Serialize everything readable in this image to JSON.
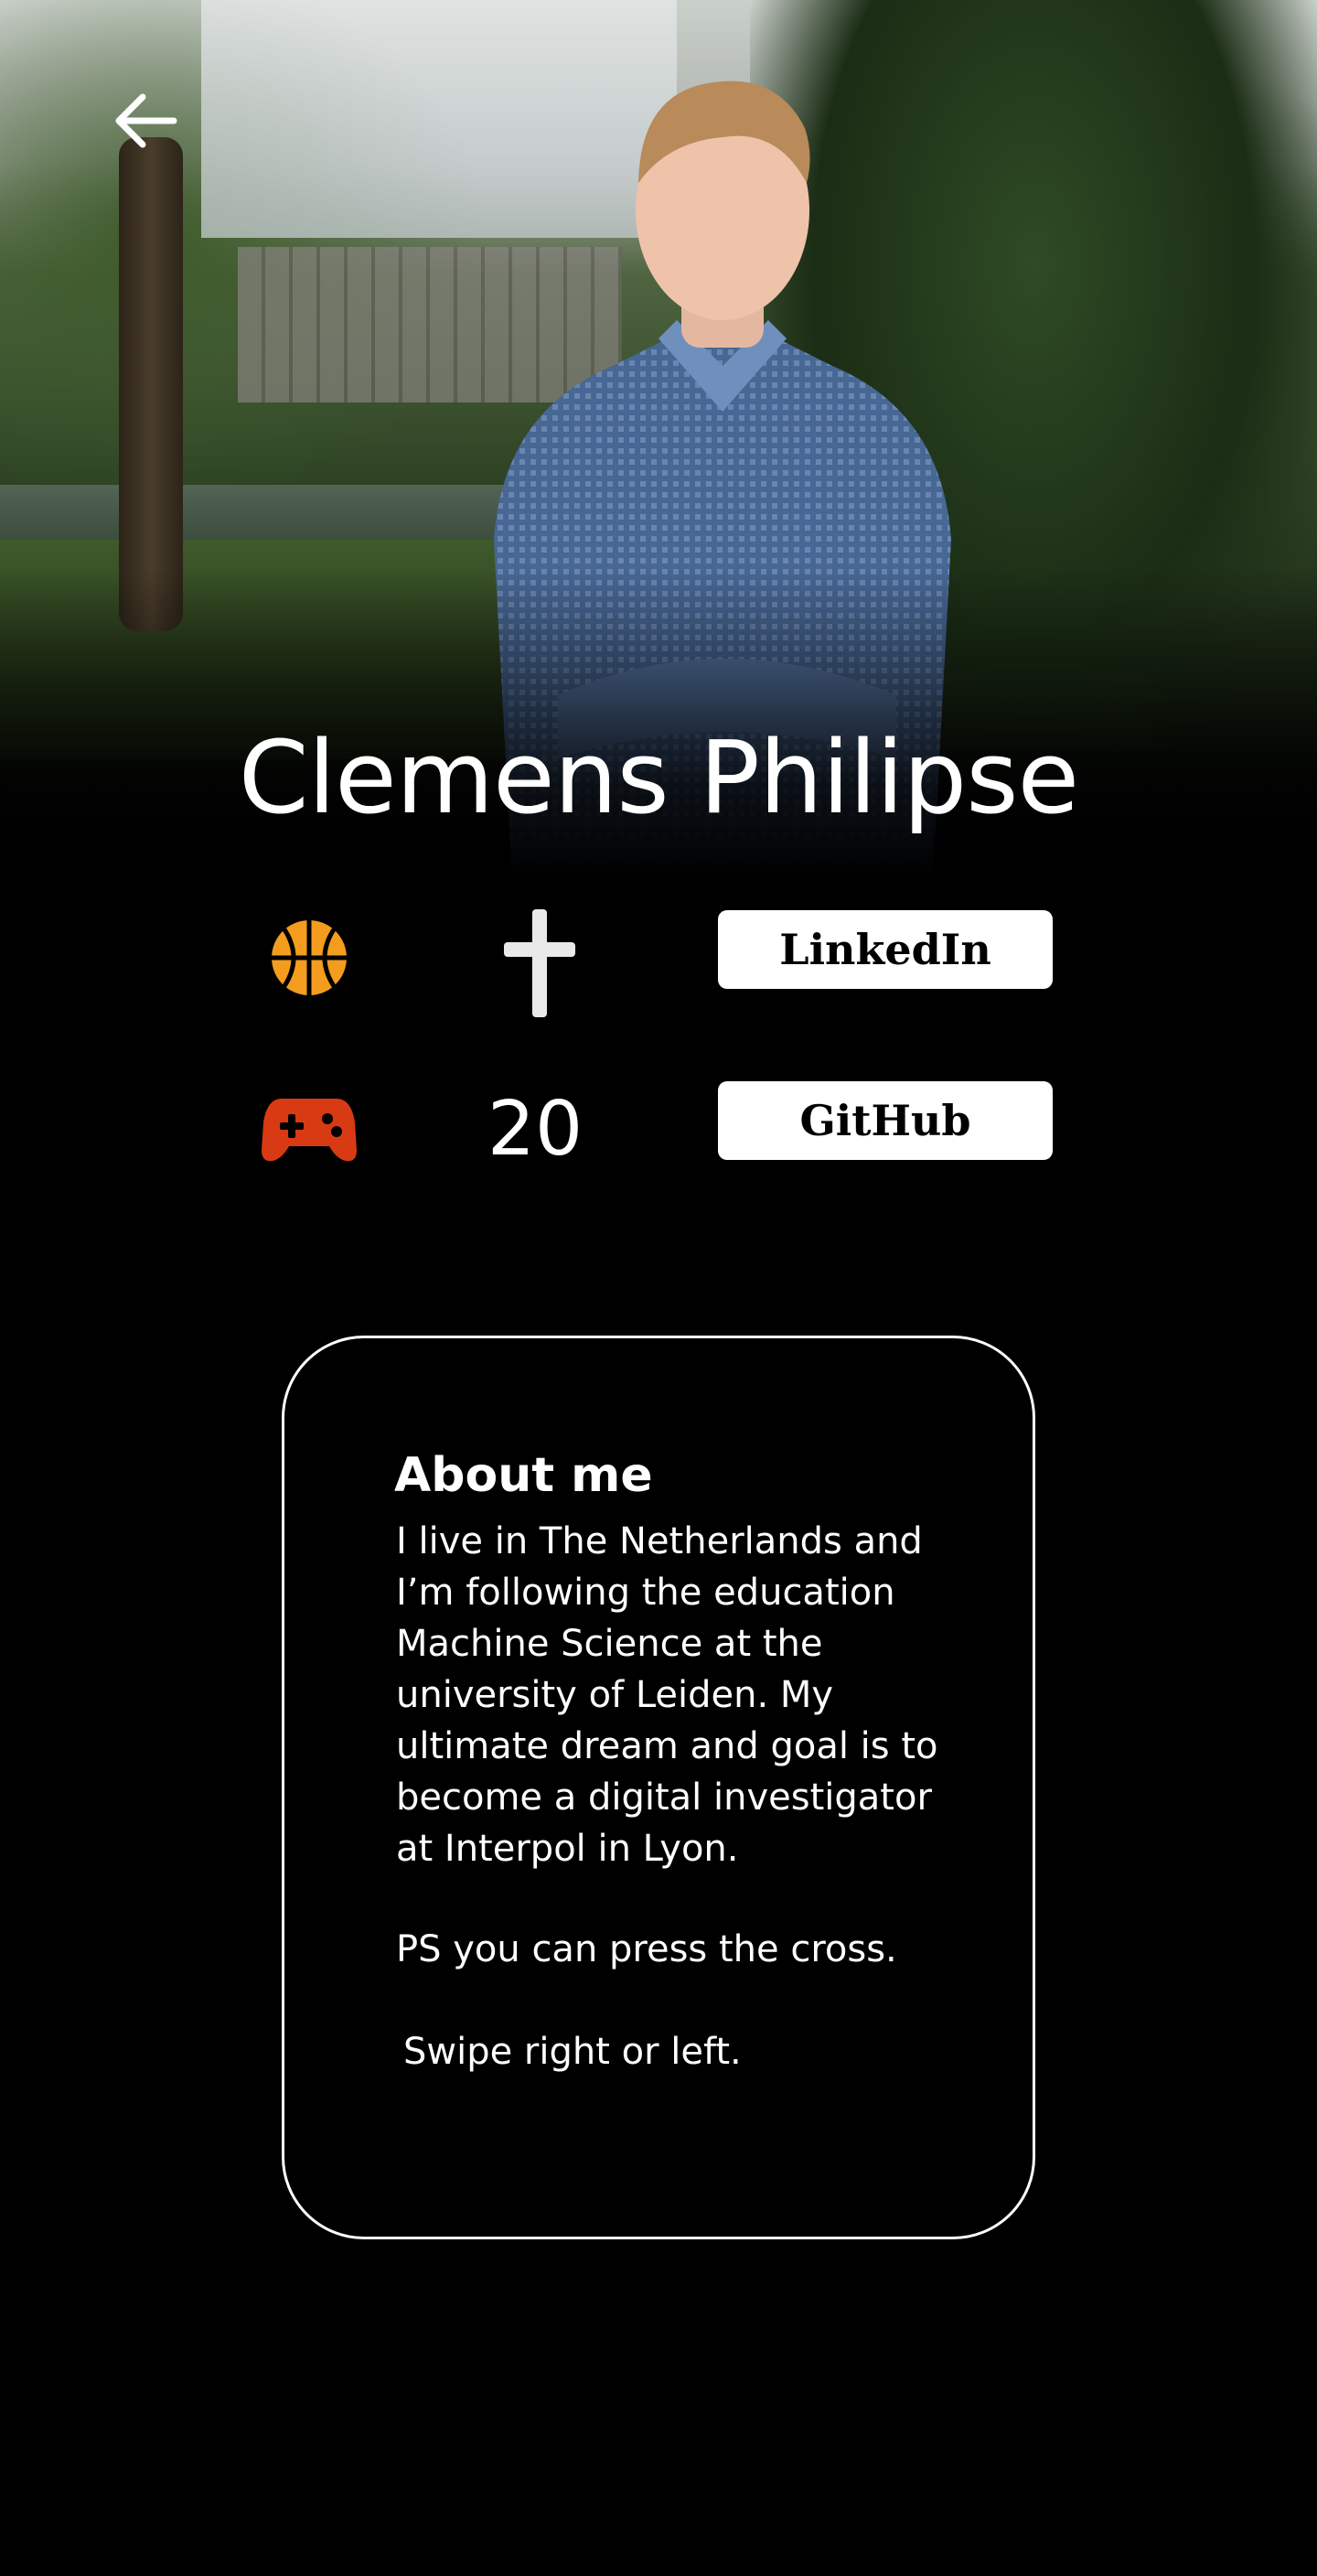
{
  "profile": {
    "name": "Clemens Philipse",
    "age": "20"
  },
  "links": {
    "linkedin_label": "LinkedIn",
    "github_label": "GitHub"
  },
  "icons": {
    "back": "arrow-left-icon",
    "hobby_sport": "basketball-icon",
    "religion": "cross-icon",
    "hobby_gaming": "gamepad-icon"
  },
  "about": {
    "title": "About me",
    "body": "I live in The Netherlands and\nI’m following the education\nMachine Science at the\nuniversity of Leiden. My\nultimate dream and goal is to\nbecome a digital investigator\nat Interpol in Lyon.",
    "ps": "PS you can press the cross.",
    "swipe": "Swipe right or left."
  },
  "colors": {
    "background": "#000000",
    "basketball": "#f39c1e",
    "gamepad": "#d83a14",
    "button_bg": "#ffffff",
    "text": "#ffffff"
  }
}
